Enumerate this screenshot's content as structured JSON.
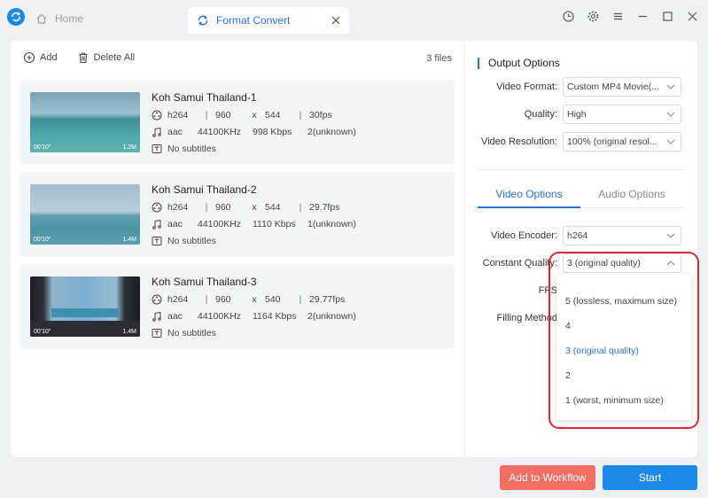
{
  "tabs": {
    "home": "Home",
    "active": "Format Convert"
  },
  "toolbar": {
    "add": "Add",
    "delete_all": "Delete All",
    "files_count": "3 files"
  },
  "files": [
    {
      "name": "Koh Samui Thailand-1",
      "codec": "h264",
      "width": "960",
      "x": "x",
      "height": "544",
      "fps": "30fps",
      "audio": "aac",
      "hz": "44100KHz",
      "kbps": "998 Kbps",
      "channels": "2(unknown)",
      "subtitles": "No subtitles",
      "duration": "00'10\"",
      "size": "1.2M"
    },
    {
      "name": "Koh Samui Thailand-2",
      "codec": "h264",
      "width": "960",
      "x": "x",
      "height": "544",
      "fps": "29.7fps",
      "audio": "aac",
      "hz": "44100KHz",
      "kbps": "1110 Kbps",
      "channels": "1(unknown)",
      "subtitles": "No subtitles",
      "duration": "00'10\"",
      "size": "1.4M"
    },
    {
      "name": "Koh Samui Thailand-3",
      "codec": "h264",
      "width": "960",
      "x": "x",
      "height": "540",
      "fps": "29.77fps",
      "audio": "aac",
      "hz": "44100KHz",
      "kbps": "1164 Kbps",
      "channels": "2(unknown)",
      "subtitles": "No subtitles",
      "duration": "00'10\"",
      "size": "1.4M"
    }
  ],
  "output": {
    "title": "Output Options",
    "video_format_label": "Video Format:",
    "video_format_value": "Custom MP4 Movie(...",
    "quality_label": "Quality:",
    "quality_value": "High",
    "resolution_label": "Video Resolution:",
    "resolution_value": "100% (original resol...",
    "tab_video": "Video Options",
    "tab_audio": "Audio Options",
    "encoder_label": "Video Encoder:",
    "encoder_value": "h264",
    "cq_label": "Constant Quality:",
    "cq_value": "3 (original quality)",
    "fps_label": "FPS",
    "filling_label": "Filling Method"
  },
  "dropdown": {
    "options": [
      "5 (lossless, maximum size)",
      "4",
      "3 (original quality)",
      "2",
      "1 (worst, minimum size)"
    ],
    "selected": "3 (original quality)"
  },
  "actions": {
    "workflow": "Add to Workflow",
    "start": "Start"
  },
  "colors": {
    "accent": "#2f6fd6",
    "start": "#1e88e5",
    "workflow": "#f26d64",
    "highlight": "#e0282e"
  }
}
